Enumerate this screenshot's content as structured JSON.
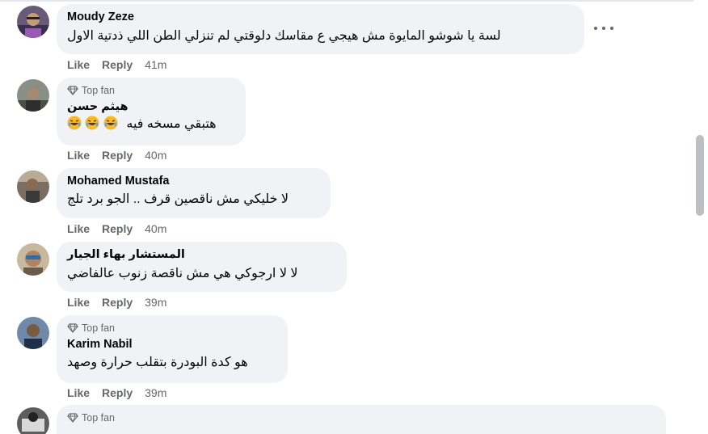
{
  "comments": [
    {
      "author": "Moudy Zeze",
      "text": "لسة يا شوشو المايوة مش هيجي ع مقاسك دلوقتي لم تنزلي الطن اللي ذدتية الاول",
      "like": "Like",
      "reply": "Reply",
      "time": "41m"
    },
    {
      "badge": "Top fan",
      "author": "هيثم حسن",
      "text": "هتبقي مسخه فيه",
      "emoji": "rolling-on-floor-laughing",
      "like": "Like",
      "reply": "Reply",
      "time": "40m"
    },
    {
      "author": "Mohamed Mustafa",
      "text": "لا خليكي مش ناقصين قرف .. الجو برد تلج",
      "like": "Like",
      "reply": "Reply",
      "time": "40m"
    },
    {
      "author": "المستشار بهاء الجيار",
      "text": "لا لا ارجوكي هي مش ناقصة زنوب عالفاضي",
      "like": "Like",
      "reply": "Reply",
      "time": "39m"
    },
    {
      "badge": "Top fan",
      "author": "Karim Nabil",
      "text": "هو كدة البودرة بتقلب حرارة وصهد",
      "like": "Like",
      "reply": "Reply",
      "time": "39m"
    },
    {
      "badge": "Top fan"
    }
  ]
}
